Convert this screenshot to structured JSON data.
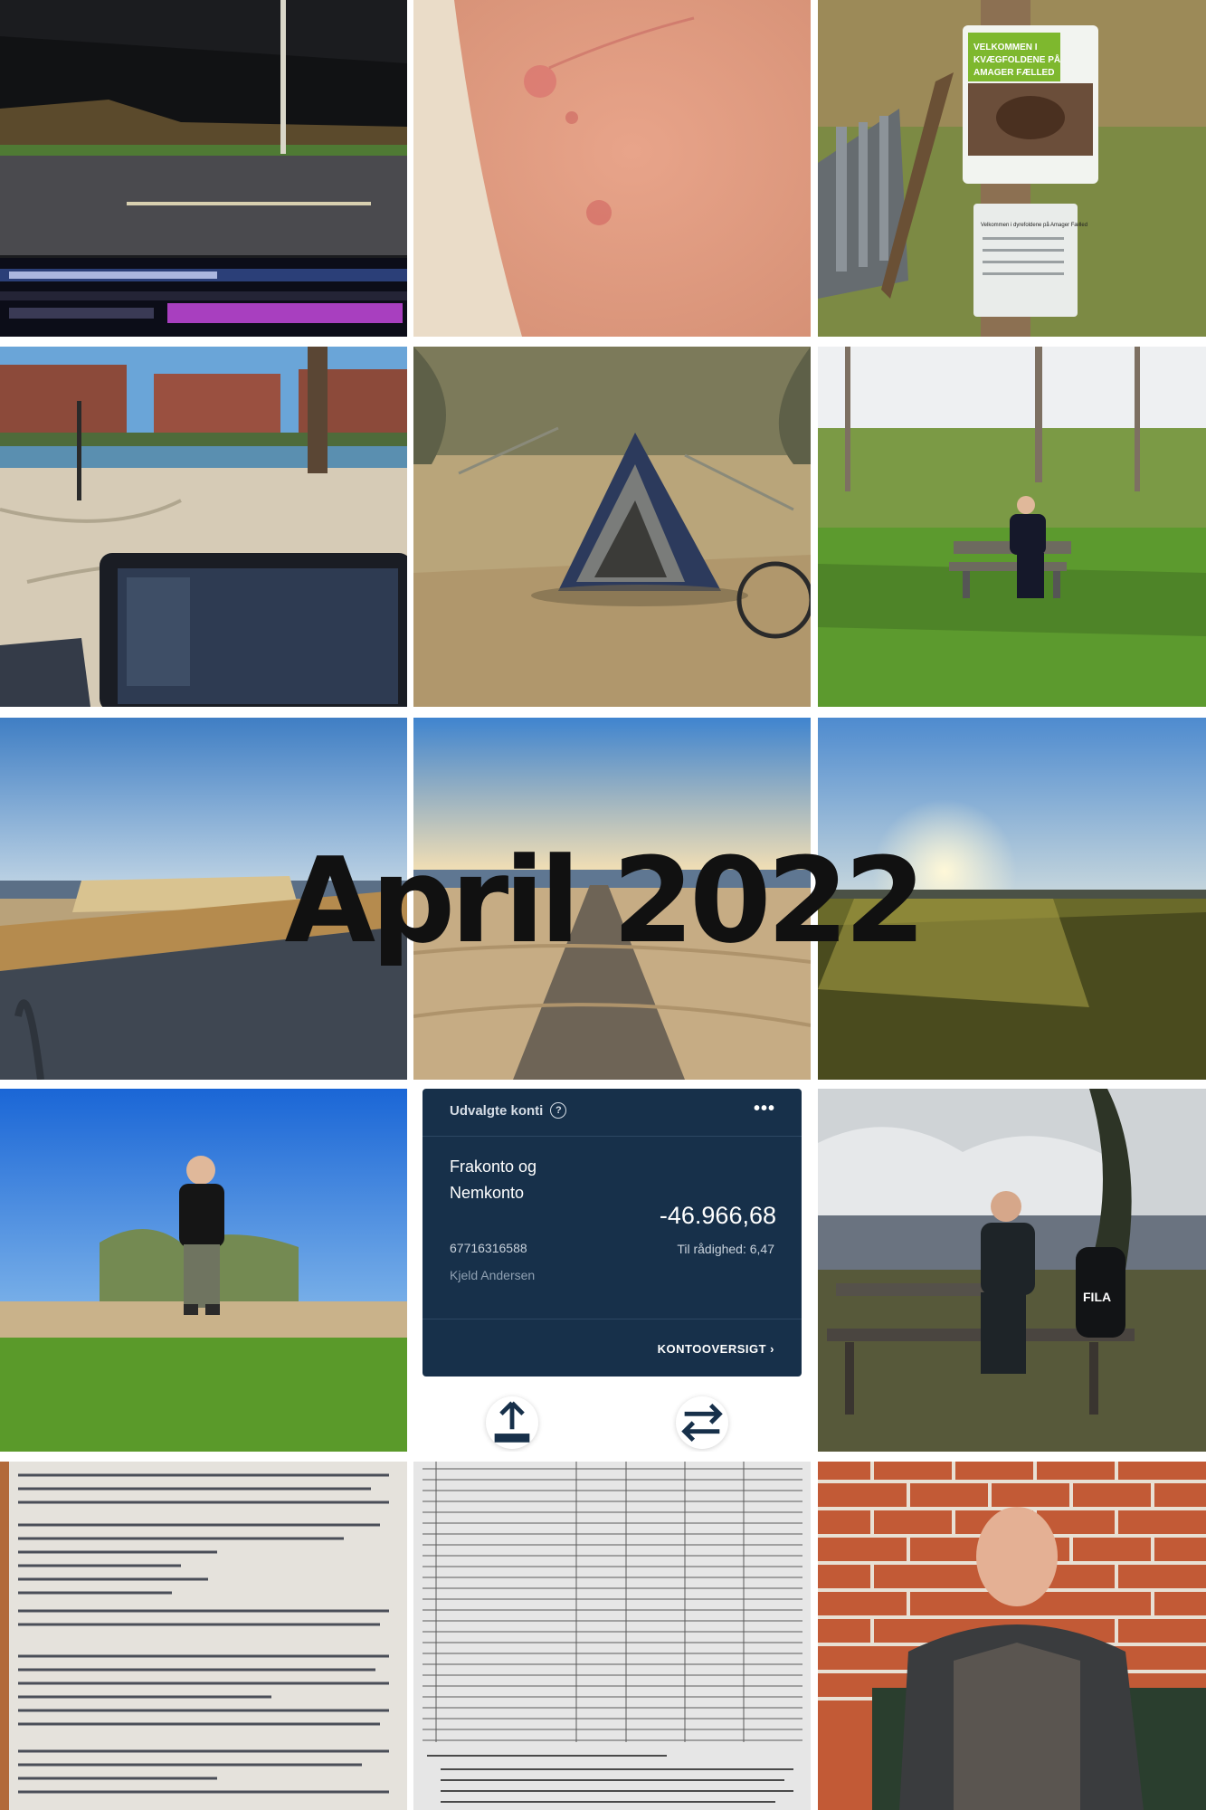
{
  "collage_title": "April 2022",
  "photos": [
    {
      "name": "night-road-laptop-photo"
    },
    {
      "name": "skin-rash-photo"
    },
    {
      "name": "cattle-sign-fence-photo"
    },
    {
      "name": "park-laptop-photo"
    },
    {
      "name": "tent-in-grass-photo"
    },
    {
      "name": "man-on-bench-woods-photo"
    },
    {
      "name": "beach-promenade-photo"
    },
    {
      "name": "beach-boardwalk-photo"
    },
    {
      "name": "sunset-field-photo"
    },
    {
      "name": "man-standing-meadow-photo"
    },
    {
      "name": "man-at-picnic-table-photo"
    },
    {
      "name": "legal-document-photo"
    },
    {
      "name": "form-document-photo"
    },
    {
      "name": "man-by-brick-wall-photo"
    }
  ],
  "bank": {
    "header": "Udvalgte konti",
    "help_icon": "?",
    "more_icon": "•••",
    "account_name": "Frakonto og Nemkonto",
    "account_number": "67716316588",
    "owner": "Kjeld Andersen",
    "balance": "-46.966,68",
    "available": "Til rådighed: 6,47",
    "link_label": "KONTOOVERSIGT ›",
    "btn1_icon": "upload-icon",
    "btn2_icon": "transfer-icon"
  },
  "sign": {
    "line1": "VELKOMMEN I",
    "line2": "KVÆGFOLDENE PÅ",
    "line3": "AMAGER FÆLLED",
    "small": "Velkommen i dyrefoldene på Amager Fælled"
  },
  "backpack_brand": "FILA"
}
